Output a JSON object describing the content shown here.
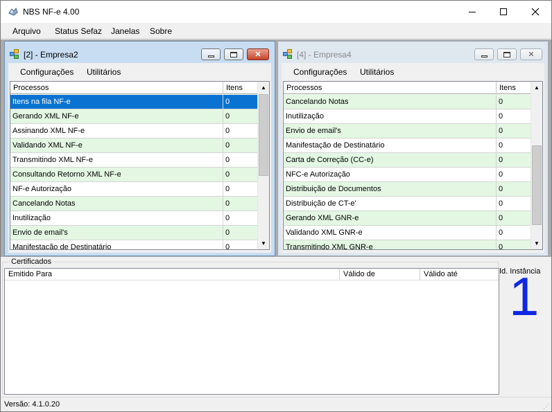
{
  "window": {
    "title": "NBS NF-e 4.00"
  },
  "menu": [
    "Arquivo",
    "Status Sefaz",
    "Janelas",
    "Sobre"
  ],
  "child1": {
    "title": "[2] - Empresa2",
    "menu": [
      "Configurações",
      "Utilitários"
    ],
    "columns": [
      "Processos",
      "Itens"
    ],
    "rows": [
      [
        "Itens na fila NF-e",
        "0"
      ],
      [
        "Gerando XML NF-e",
        "0"
      ],
      [
        "Assinando XML NF-e",
        "0"
      ],
      [
        "Validando XML NF-e",
        "0"
      ],
      [
        "Transmitindo XML NF-e",
        "0"
      ],
      [
        "Consultando Retorno XML NF-e",
        "0"
      ],
      [
        "NF-e Autorização",
        "0"
      ],
      [
        "Cancelando Notas",
        "0"
      ],
      [
        "Inutilização",
        "0"
      ],
      [
        "Envio de email's",
        "0"
      ],
      [
        "Manifestação de Destinatário",
        "0"
      ]
    ]
  },
  "child2": {
    "title": "[4] - Empresa4",
    "menu": [
      "Configurações",
      "Utilitários"
    ],
    "columns": [
      "Processos",
      "Itens"
    ],
    "rows": [
      [
        "Cancelando Notas",
        "0"
      ],
      [
        "Inutilização",
        "0"
      ],
      [
        "Envio de email's",
        "0"
      ],
      [
        "Manifestação de Destinatário",
        "0"
      ],
      [
        "Carta de Correção (CC-e)",
        "0"
      ],
      [
        "NFC-e Autorização",
        "0"
      ],
      [
        "Distribuição de Documentos",
        "0"
      ],
      [
        "Distribuição de CT-e'",
        "0"
      ],
      [
        "Gerando XML GNR-e",
        "0"
      ],
      [
        "Validando XML GNR-e",
        "0"
      ],
      [
        "Transmitindo XML GNR-e",
        "0"
      ]
    ]
  },
  "certificados": {
    "legend": "Certificados",
    "columns": [
      "Emitido Para",
      "Válido de",
      "Válido até"
    ]
  },
  "instance": {
    "label": "Id. Instância",
    "number": "1"
  },
  "status": {
    "version": "Versão: 4.1.0.20"
  },
  "colors": {
    "selection": "#0a73d1",
    "alt_row": "#e3f7e3",
    "instance_number": "#1027e2"
  }
}
